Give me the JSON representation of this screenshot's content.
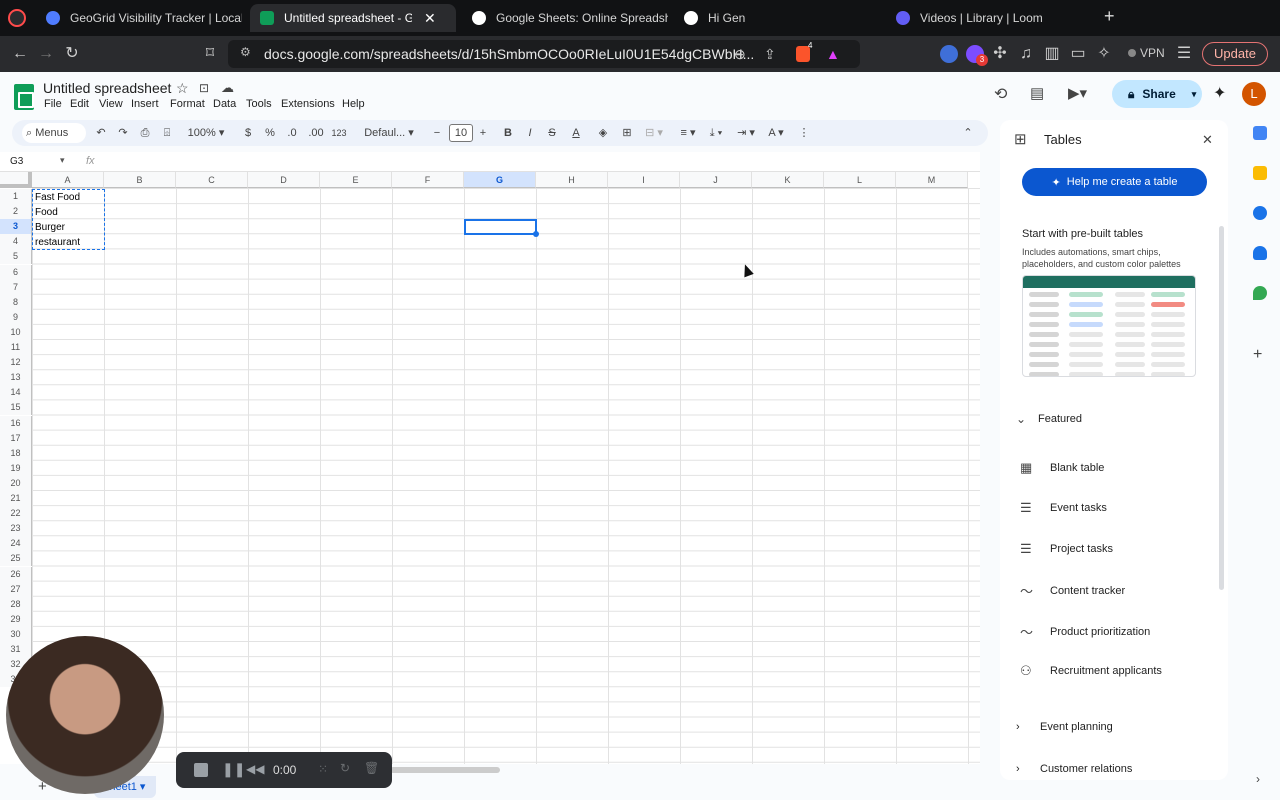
{
  "browser": {
    "tabs": [
      {
        "title": "GeoGrid Visibility Tracker | LocalV",
        "color": "#4f7cff"
      },
      {
        "title": "Untitled spreadsheet - Go",
        "color": "#0f9d58",
        "active": true
      },
      {
        "title": "Google Sheets: Online Spreadshe",
        "color": "#ffffff"
      },
      {
        "title": "Hi Gen",
        "color": "#ffffff"
      },
      {
        "title": "Videos | Library | Loom",
        "color": "#625df5"
      }
    ],
    "new_tab": "+",
    "url": "docs.google.com/spreadsheets/d/15hSmbmOCOo0RIeLuI0U1E54dgCBWbH...",
    "vpn": "VPN",
    "update": "Update",
    "brave_badge": "4",
    "ext_badge": "3"
  },
  "doc": {
    "title": "Untitled spreadsheet",
    "menus": [
      "File",
      "Edit",
      "View",
      "Insert",
      "Format",
      "Data",
      "Tools",
      "Extensions",
      "Help"
    ],
    "share": "Share",
    "avatar": "L"
  },
  "toolbar": {
    "search": "Menus",
    "zoom": "100%",
    "currency": "$",
    "percent": "%",
    "dec_less": ".0",
    "dec_more": ".00",
    "number_format": "123",
    "font": "Defaul...",
    "font_size": "10"
  },
  "formula_bar": {
    "cell_ref": "G3",
    "fx": "fx",
    "value": ""
  },
  "grid": {
    "columns": [
      "A",
      "B",
      "C",
      "D",
      "E",
      "F",
      "G",
      "H",
      "I",
      "J",
      "K",
      "L",
      "M"
    ],
    "selected_column": "G",
    "rows": [
      "1",
      "2",
      "3",
      "4",
      "5",
      "6",
      "7",
      "8",
      "9",
      "10",
      "11",
      "12",
      "13",
      "14",
      "15",
      "16",
      "17",
      "18",
      "19",
      "20",
      "21",
      "22",
      "23",
      "24",
      "25",
      "26",
      "27",
      "28",
      "29",
      "30",
      "31",
      "32",
      "33"
    ],
    "selected_row": "3",
    "cells_A": [
      "Fast Food",
      "Food",
      "Burger",
      "restaurant"
    ]
  },
  "panel": {
    "title": "Tables",
    "help_button": "Help me create a table",
    "prebuilt_title": "Start with pre-built tables",
    "prebuilt_desc": "Includes automations, smart chips, placeholders, and custom color palettes",
    "featured": "Featured",
    "items": [
      "Blank table",
      "Event tasks",
      "Project tasks",
      "Content tracker",
      "Product prioritization",
      "Recruitment applicants"
    ],
    "sections": [
      "Event planning",
      "Customer relations"
    ]
  },
  "loom": {
    "time": "0:00"
  },
  "sheet_tab": "Sheet1"
}
